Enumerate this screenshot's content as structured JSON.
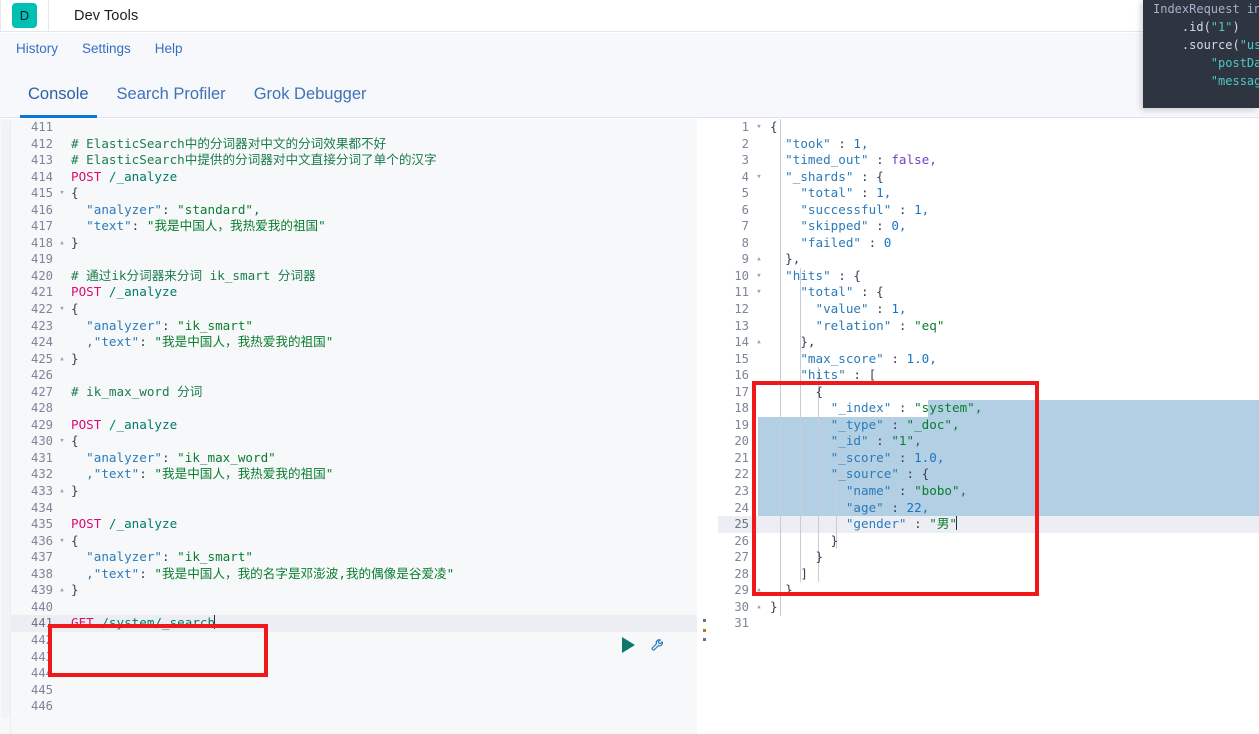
{
  "header": {
    "logo_letter": "D",
    "title": "Dev Tools"
  },
  "menu": {
    "items": [
      {
        "label": "History"
      },
      {
        "label": "Settings"
      },
      {
        "label": "Help"
      }
    ]
  },
  "tabs": [
    {
      "label": "Console",
      "active": true
    },
    {
      "label": "Search Profiler",
      "active": false
    },
    {
      "label": "Grok Debugger",
      "active": false
    }
  ],
  "editor": {
    "request_pane": {
      "first_line_number": 411,
      "active_line_number": 441,
      "lines": [
        {
          "num": 411,
          "fold": "",
          "text": ""
        },
        {
          "num": 412,
          "fold": "",
          "text": "# ElasticSearch中的分词器对中文的分词效果都不好",
          "style": "comment"
        },
        {
          "num": 413,
          "fold": "",
          "text": "# ElasticSearch中提供的分词器对中文直接分词了单个的汉字",
          "style": "comment"
        },
        {
          "num": 414,
          "fold": "",
          "method": "POST",
          "url": " /_analyze"
        },
        {
          "num": 415,
          "fold": "▾",
          "text": "{",
          "style": "punct"
        },
        {
          "num": 416,
          "fold": "",
          "key": "  \"analyzer\"",
          "sep": ": ",
          "val": "\"standard\",",
          "style": "kv"
        },
        {
          "num": 417,
          "fold": "",
          "key": "  \"text\"",
          "sep": ": ",
          "val": "\"我是中国人，我热爱我的祖国\"",
          "style": "kv"
        },
        {
          "num": 418,
          "fold": "▴",
          "text": "}",
          "style": "punct"
        },
        {
          "num": 419,
          "fold": "",
          "text": ""
        },
        {
          "num": 420,
          "fold": "",
          "text": "# 通过ik分词器来分词 ik_smart 分词器",
          "style": "comment"
        },
        {
          "num": 421,
          "fold": "",
          "method": "POST",
          "url": " /_analyze"
        },
        {
          "num": 422,
          "fold": "▾",
          "text": "{",
          "style": "punct"
        },
        {
          "num": 423,
          "fold": "",
          "key": "  \"analyzer\"",
          "sep": ": ",
          "val": "\"ik_smart\"",
          "style": "kv"
        },
        {
          "num": 424,
          "fold": "",
          "key": "  ,\"text\"",
          "sep": ": ",
          "val": "\"我是中国人，我热爱我的祖国\"",
          "style": "kv"
        },
        {
          "num": 425,
          "fold": "▴",
          "text": "}",
          "style": "punct"
        },
        {
          "num": 426,
          "fold": "",
          "text": ""
        },
        {
          "num": 427,
          "fold": "",
          "text": "# ik_max_word 分词",
          "style": "comment"
        },
        {
          "num": 428,
          "fold": "",
          "text": ""
        },
        {
          "num": 429,
          "fold": "",
          "method": "POST",
          "url": " /_analyze"
        },
        {
          "num": 430,
          "fold": "▾",
          "text": "{",
          "style": "punct"
        },
        {
          "num": 431,
          "fold": "",
          "key": "  \"analyzer\"",
          "sep": ": ",
          "val": "\"ik_max_word\"",
          "style": "kv"
        },
        {
          "num": 432,
          "fold": "",
          "key": "  ,\"text\"",
          "sep": ": ",
          "val": "\"我是中国人，我热爱我的祖国\"",
          "style": "kv"
        },
        {
          "num": 433,
          "fold": "▴",
          "text": "}",
          "style": "punct"
        },
        {
          "num": 434,
          "fold": "",
          "text": ""
        },
        {
          "num": 435,
          "fold": "",
          "method": "POST",
          "url": " /_analyze"
        },
        {
          "num": 436,
          "fold": "▾",
          "text": "{",
          "style": "punct"
        },
        {
          "num": 437,
          "fold": "",
          "key": "  \"analyzer\"",
          "sep": ": ",
          "val": "\"ik_smart\"",
          "style": "kv"
        },
        {
          "num": 438,
          "fold": "",
          "key": "  ,\"text\"",
          "sep": ": ",
          "val": "\"我是中国人，我的名字是邓澎波,我的偶像是谷爱凌\"",
          "style": "kv"
        },
        {
          "num": 439,
          "fold": "▴",
          "text": "}",
          "style": "punct"
        },
        {
          "num": 440,
          "fold": "",
          "text": ""
        },
        {
          "num": 441,
          "fold": "",
          "method": "GET",
          "url": " /system/_search",
          "active": true,
          "caret": true
        },
        {
          "num": 442,
          "fold": "",
          "text": ""
        },
        {
          "num": 443,
          "fold": "",
          "text": ""
        },
        {
          "num": 444,
          "fold": "",
          "text": ""
        },
        {
          "num": 445,
          "fold": "",
          "text": ""
        },
        {
          "num": 446,
          "fold": "",
          "text": ""
        }
      ]
    },
    "response_pane": {
      "active_line_number": 25,
      "lines": [
        {
          "num": 1,
          "fold": "▾",
          "text": "{",
          "style": "punct"
        },
        {
          "num": 2,
          "fold": "",
          "key": "  \"took\"",
          "sep": " : ",
          "val": "1,",
          "vtype": "num"
        },
        {
          "num": 3,
          "fold": "",
          "key": "  \"timed_out\"",
          "sep": " : ",
          "val": "false,",
          "vtype": "bool"
        },
        {
          "num": 4,
          "fold": "▾",
          "key": "  \"_shards\"",
          "sep": " : ",
          "val": "{",
          "vtype": "punct"
        },
        {
          "num": 5,
          "fold": "",
          "key": "    \"total\"",
          "sep": " : ",
          "val": "1,",
          "vtype": "num"
        },
        {
          "num": 6,
          "fold": "",
          "key": "    \"successful\"",
          "sep": " : ",
          "val": "1,",
          "vtype": "num"
        },
        {
          "num": 7,
          "fold": "",
          "key": "    \"skipped\"",
          "sep": " : ",
          "val": "0,",
          "vtype": "num"
        },
        {
          "num": 8,
          "fold": "",
          "key": "    \"failed\"",
          "sep": " : ",
          "val": "0",
          "vtype": "num"
        },
        {
          "num": 9,
          "fold": "▴",
          "text": "  },",
          "style": "punct"
        },
        {
          "num": 10,
          "fold": "▾",
          "key": "  \"hits\"",
          "sep": " : ",
          "val": "{",
          "vtype": "punct"
        },
        {
          "num": 11,
          "fold": "▾",
          "key": "    \"total\"",
          "sep": " : ",
          "val": "{",
          "vtype": "punct"
        },
        {
          "num": 12,
          "fold": "",
          "key": "      \"value\"",
          "sep": " : ",
          "val": "1,",
          "vtype": "num"
        },
        {
          "num": 13,
          "fold": "",
          "key": "      \"relation\"",
          "sep": " : ",
          "val": "\"eq\"",
          "vtype": "str"
        },
        {
          "num": 14,
          "fold": "▴",
          "text": "    },",
          "style": "punct"
        },
        {
          "num": 15,
          "fold": "",
          "key": "    \"max_score\"",
          "sep": " : ",
          "val": "1.0,",
          "vtype": "num"
        },
        {
          "num": 16,
          "fold": "",
          "key": "    \"hits\"",
          "sep": " : ",
          "val": "[",
          "vtype": "punct"
        },
        {
          "num": 17,
          "fold": "",
          "text": "      {",
          "style": "punct"
        },
        {
          "num": 18,
          "fold": "",
          "key": "        \"_index\"",
          "sep": " : ",
          "val": "\"system\",",
          "vtype": "str"
        },
        {
          "num": 19,
          "fold": "",
          "key": "        \"_type\"",
          "sep": " : ",
          "val": "\"_doc\",",
          "vtype": "str"
        },
        {
          "num": 20,
          "fold": "",
          "key": "        \"_id\"",
          "sep": " : ",
          "val": "\"1\",",
          "vtype": "str"
        },
        {
          "num": 21,
          "fold": "",
          "key": "        \"_score\"",
          "sep": " : ",
          "val": "1.0,",
          "vtype": "num"
        },
        {
          "num": 22,
          "fold": "",
          "key": "        \"_source\"",
          "sep": " : ",
          "val": "{",
          "vtype": "punct"
        },
        {
          "num": 23,
          "fold": "",
          "key": "          \"name\"",
          "sep": " : ",
          "val": "\"bobo\",",
          "vtype": "str"
        },
        {
          "num": 24,
          "fold": "",
          "key": "          \"age\"",
          "sep": " : ",
          "val": "22,",
          "vtype": "num"
        },
        {
          "num": 25,
          "fold": "",
          "key": "          \"gender\"",
          "sep": " : ",
          "val": "\"男\"",
          "vtype": "str",
          "active": true,
          "caret": true
        },
        {
          "num": 26,
          "fold": "",
          "text": "        }",
          "style": "punct"
        },
        {
          "num": 27,
          "fold": "",
          "text": "      }",
          "style": "punct"
        },
        {
          "num": 28,
          "fold": "",
          "text": "    ]",
          "style": "punct"
        },
        {
          "num": 29,
          "fold": "▴",
          "text": "  }",
          "style": "punct"
        },
        {
          "num": 30,
          "fold": "▴",
          "text": "}",
          "style": "punct"
        },
        {
          "num": 31,
          "fold": "",
          "text": ""
        }
      ]
    }
  },
  "controls": {
    "play_label": "send-request",
    "wrench_label": "request-options"
  },
  "overlay_code": {
    "lines": [
      {
        "segments": [
          {
            "t": "IndexRequest ind",
            "c": "cls"
          }
        ]
      },
      {
        "segments": [
          {
            "t": "    .id(",
            "c": "mth"
          },
          {
            "t": "\"1\"",
            "c": "str"
          },
          {
            "t": ")",
            "c": "mth"
          }
        ]
      },
      {
        "segments": [
          {
            "t": "    .source(",
            "c": "mth"
          },
          {
            "t": "\"use",
            "c": "str"
          }
        ]
      },
      {
        "segments": [
          {
            "t": "        ",
            "c": "plain"
          },
          {
            "t": "\"postDat",
            "c": "str"
          }
        ]
      },
      {
        "segments": [
          {
            "t": "        ",
            "c": "plain"
          },
          {
            "t": "\"message\"",
            "c": "str"
          }
        ]
      }
    ]
  },
  "colors": {
    "brand_teal": "#00bfb3",
    "tab_active_underline": "#0877d8",
    "annotation_red": "#f01818",
    "selection_blue": "#b3cfe3",
    "play_green": "#0b7a6b",
    "overlay_bg": "#2f3441"
  }
}
